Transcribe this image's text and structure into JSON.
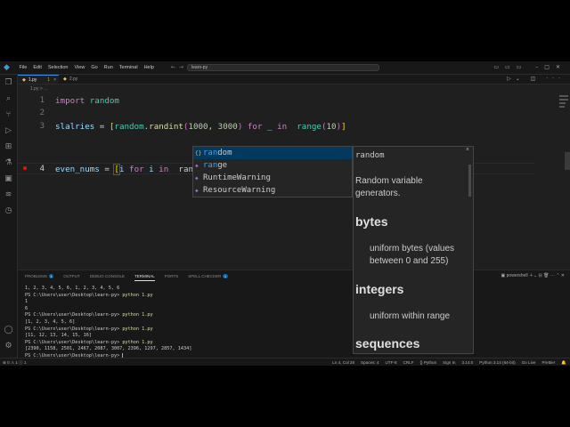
{
  "window": {
    "menu": [
      "File",
      "Edit",
      "Selection",
      "View",
      "Go",
      "Run",
      "Terminal",
      "Help"
    ],
    "search_text": "learn-py"
  },
  "tabs": [
    {
      "label": "1.py",
      "badge": "1",
      "active": true
    },
    {
      "label": "2.py",
      "badge": "",
      "active": false
    }
  ],
  "breadcrumb": "1.py > ...",
  "editor": {
    "lines": [
      {
        "num": "1"
      },
      {
        "num": "2"
      },
      {
        "num": "3"
      },
      {
        "num": "4"
      }
    ],
    "line1": {
      "kw": "import",
      "mod": "random"
    },
    "line3": {
      "var": "slalries",
      "eq": " = ",
      "br": "[",
      "mod": "random",
      "dot": ".",
      "fn": "randint",
      "p1": "(",
      "a": "1000",
      "comma": ", ",
      "b": "3000",
      "p2": ")",
      "for": " for ",
      "us": "_",
      "in": " in ",
      "range": "range",
      "p3": "(",
      "c": "10",
      "p4": ")",
      "brc": "]"
    },
    "line4": {
      "var": "even_nums",
      "eq": " = ",
      "br": "[",
      "i1": "i",
      "for": " for ",
      "i2": "i",
      "in": " in ",
      "typed": "ran",
      "brc": "]"
    }
  },
  "suggestions": [
    {
      "icon": "module-icon",
      "match": "ran",
      "rest": "dom",
      "selected": true
    },
    {
      "icon": "class-icon",
      "match": "ran",
      "rest": "ge",
      "selected": false
    },
    {
      "icon": "class-icon",
      "match": "",
      "rest": "RuntimeWarning",
      "selected": false
    },
    {
      "icon": "class-icon",
      "match": "",
      "rest": "ResourceWarning",
      "selected": false
    }
  ],
  "details": {
    "title": "random",
    "close": "×",
    "description": "Random variable generators.",
    "sections": [
      {
        "heading": "bytes",
        "text": "uniform bytes (values between 0 and 255)"
      },
      {
        "heading": "integers",
        "text": "uniform within range"
      },
      {
        "heading": "sequences",
        "text": ""
      }
    ]
  },
  "panel": {
    "tabs": [
      {
        "label": "PROBLEMS",
        "badge": "1",
        "active": false
      },
      {
        "label": "OUTPUT",
        "badge": "",
        "active": false
      },
      {
        "label": "DEBUG CONSOLE",
        "badge": "",
        "active": false
      },
      {
        "label": "TERMINAL",
        "badge": "",
        "active": true
      },
      {
        "label": "PORTS",
        "badge": "",
        "active": false
      },
      {
        "label": "SPELL CHECKER",
        "badge": "1",
        "active": false
      }
    ],
    "shell": "powershell",
    "terminal": [
      {
        "prompt": "",
        "cmd": "",
        "text": "1, 2, 3, 4, 5, 6, 1, 2, 3, 4, 5, 6"
      },
      {
        "prompt": "PS C:\\Users\\user\\Desktop\\learn-py> ",
        "cmd": "python 1.py",
        "text": ""
      },
      {
        "prompt": "",
        "cmd": "",
        "text": "1"
      },
      {
        "prompt": "",
        "cmd": "",
        "text": "6"
      },
      {
        "prompt": "PS C:\\Users\\user\\Desktop\\learn-py> ",
        "cmd": "python 1.py",
        "text": ""
      },
      {
        "prompt": "",
        "cmd": "",
        "text": "[1, 2, 3, 4, 5, 6]"
      },
      {
        "prompt": "PS C:\\Users\\user\\Desktop\\learn-py> ",
        "cmd": "python 1.py",
        "text": ""
      },
      {
        "prompt": "",
        "cmd": "",
        "text": "[11, 12, 13, 14, 15, 16]"
      },
      {
        "prompt": "PS C:\\Users\\user\\Desktop\\learn-py> ",
        "cmd": "python 1.py",
        "text": ""
      },
      {
        "prompt": "",
        "cmd": "",
        "text": "[2390, 1158, 2501, 2467, 2087, 3007, 2396, 1297, 2857, 1434]"
      },
      {
        "prompt": "PS C:\\Users\\user\\Desktop\\learn-py> ",
        "cmd": "",
        "text": ""
      }
    ]
  },
  "status": {
    "left": "⊗ 0 ⚠ 1 ⓘ 1",
    "right": [
      "Ln 4, Col 28",
      "Spaces: 4",
      "UTF-8",
      "CRLF",
      "{} Python",
      "Sign In",
      "3.14.0",
      "Python 3.14 (64-bit)",
      "Go Live",
      "Prettier"
    ]
  },
  "colors": {
    "accent": "#0e639c",
    "breakpoint": "#e51400",
    "selection": "#04395e"
  }
}
